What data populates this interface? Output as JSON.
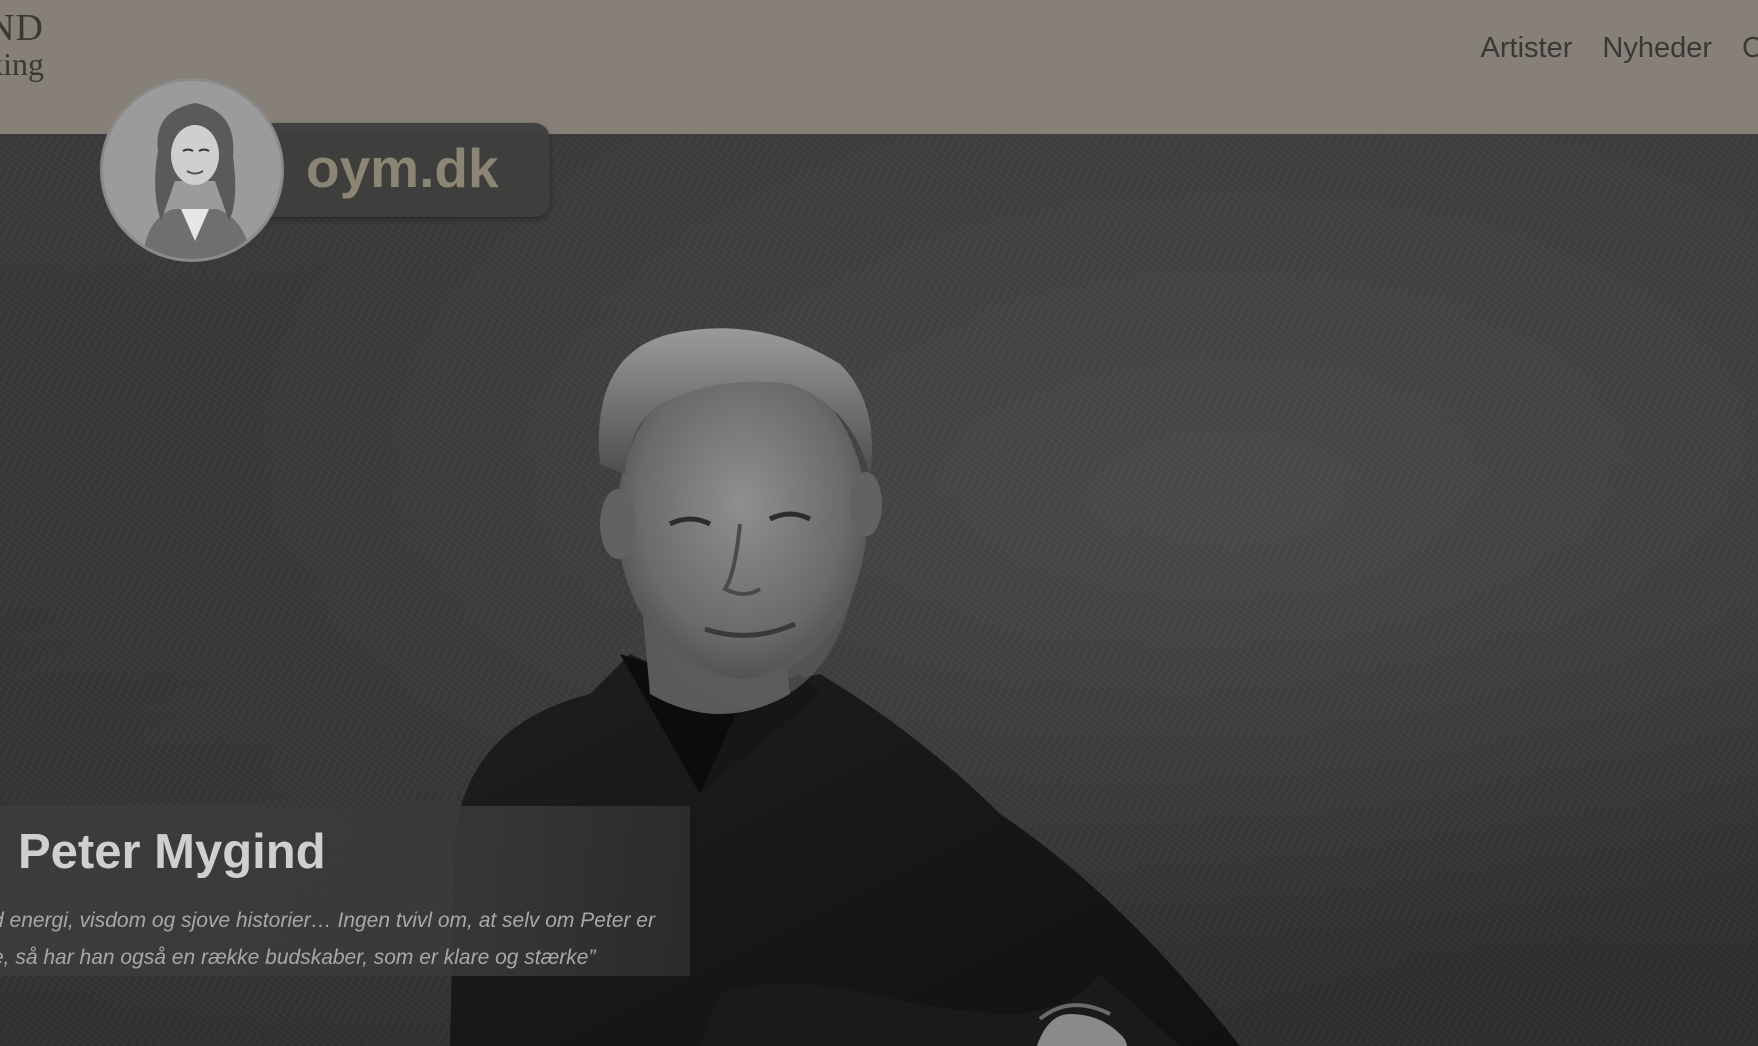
{
  "header": {
    "logo": {
      "line1": "ND",
      "line2": "king"
    },
    "nav": [
      {
        "label": "Artister"
      },
      {
        "label": "Nyheder"
      },
      {
        "label": "C"
      }
    ]
  },
  "hero": {
    "name": "Peter Mygind",
    "quote_line1": "d energi, visdom og sjove historier… Ingen tvivl om, at selv om Peter er",
    "quote_line2": "e, så har han også en række budskaber, som er klare og stærke”"
  },
  "badge": {
    "site": "oym.dk"
  },
  "colors": {
    "header_bg": "#868079",
    "hero_bg": "#353535",
    "badge_text": "#8b8674",
    "name_text": "#cfcfcf"
  }
}
